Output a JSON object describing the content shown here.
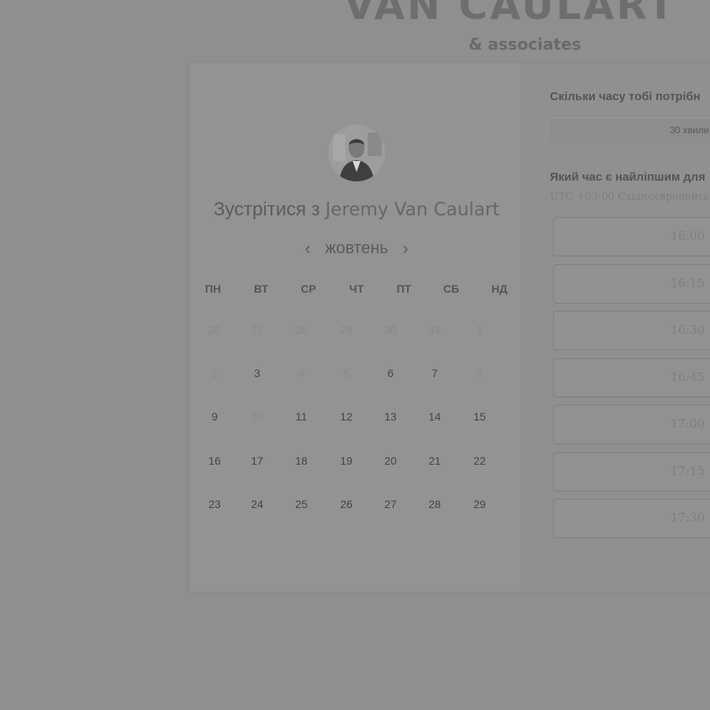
{
  "brand": {
    "title": "VAN CAULART",
    "subtitle": "& associates"
  },
  "booking": {
    "title_prefix": "Зустрітися з",
    "host_name": "Jeremy Van Caulart",
    "month": "жовтень",
    "prev_icon": "chevron-left-icon",
    "next_icon": "chevron-right-icon",
    "weekdays": [
      "ПН",
      "ВТ",
      "СР",
      "ЧТ",
      "ПТ",
      "СБ",
      "НД"
    ],
    "weeks": [
      [
        {
          "d": "26",
          "muted": true
        },
        {
          "d": "27",
          "muted": true
        },
        {
          "d": "28",
          "muted": true
        },
        {
          "d": "29",
          "muted": true
        },
        {
          "d": "30",
          "muted": true
        },
        {
          "d": "31",
          "muted": true
        },
        {
          "d": "1",
          "muted": true
        }
      ],
      [
        {
          "d": "2",
          "muted": true
        },
        {
          "d": "3",
          "muted": false
        },
        {
          "d": "4",
          "muted": true
        },
        {
          "d": "5",
          "muted": true
        },
        {
          "d": "6",
          "muted": false
        },
        {
          "d": "7",
          "muted": false
        },
        {
          "d": "8",
          "muted": true
        }
      ],
      [
        {
          "d": "9",
          "muted": false
        },
        {
          "d": "10",
          "muted": true
        },
        {
          "d": "11",
          "muted": false
        },
        {
          "d": "12",
          "muted": false
        },
        {
          "d": "13",
          "muted": false
        },
        {
          "d": "14",
          "muted": false
        },
        {
          "d": "15",
          "muted": false
        }
      ],
      [
        {
          "d": "16",
          "muted": false
        },
        {
          "d": "17",
          "muted": false
        },
        {
          "d": "18",
          "muted": false
        },
        {
          "d": "19",
          "muted": false
        },
        {
          "d": "20",
          "muted": false
        },
        {
          "d": "21",
          "muted": false
        },
        {
          "d": "22",
          "muted": false
        }
      ],
      [
        {
          "d": "23",
          "muted": false
        },
        {
          "d": "24",
          "muted": false
        },
        {
          "d": "25",
          "muted": false
        },
        {
          "d": "26",
          "muted": false
        },
        {
          "d": "27",
          "muted": false
        },
        {
          "d": "28",
          "muted": false
        },
        {
          "d": "29",
          "muted": false
        }
      ]
    ]
  },
  "side": {
    "duration_question": "Скільки часу тобі потрібн",
    "duration_option": "30 хвили",
    "time_question": "Який час є найліпшим для",
    "timezone": "UTC +03:00 Східноєвропейсь",
    "slots": [
      "16:00",
      "16:15",
      "16:30",
      "16:45",
      "17:00",
      "17:15",
      "17:30"
    ]
  },
  "colors": {
    "overlay": "#8f8f8f",
    "card": "#939393"
  }
}
